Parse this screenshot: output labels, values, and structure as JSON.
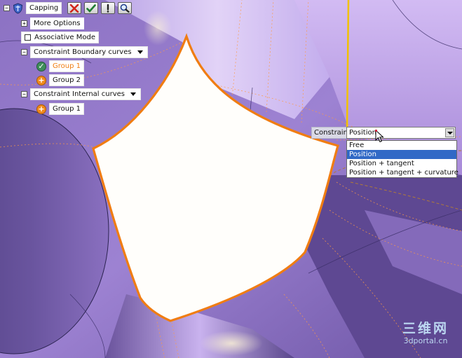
{
  "toolbar": {
    "title": "Capping",
    "icons": [
      "shield-icon",
      "cancel-x-icon",
      "check-icon",
      "exclamation-icon",
      "magnifier-icon"
    ]
  },
  "tree": {
    "more_options": "More Options",
    "associative_mode": "Associative Mode",
    "boundary_header": "Constraint Boundary curves",
    "boundary_groups": [
      "Group 1",
      "Group 2"
    ],
    "internal_header": "Constraint Internal curves",
    "internal_groups": [
      "Group 1"
    ]
  },
  "constraint": {
    "label": "Constraint",
    "selected": "Position",
    "options": [
      "Free",
      "Position",
      "Position + tangent",
      "Position + tangent + curvature"
    ],
    "selected_index": 1
  },
  "watermark": {
    "big": "三维网",
    "small": "3dportal.cn"
  },
  "colors": {
    "accent_orange": "#f07d12",
    "selection_blue": "#3169c6",
    "surface_purple": "#7a5fb0",
    "highlight_yellow": "#f2c200"
  }
}
